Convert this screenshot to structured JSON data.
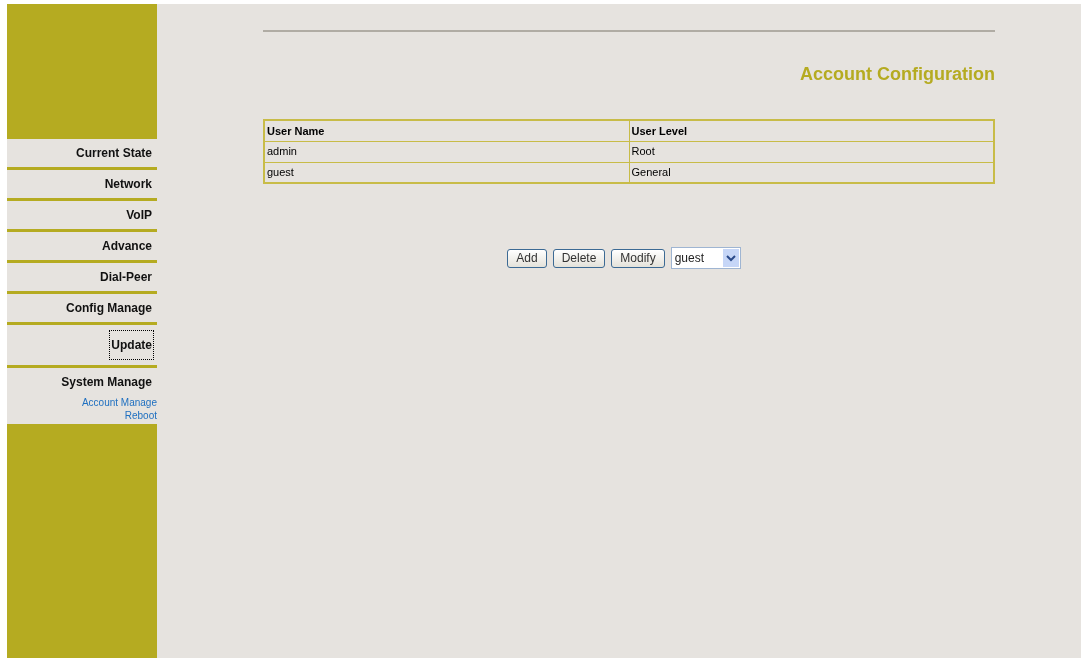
{
  "sidebar": {
    "items": [
      {
        "label": "Current State",
        "focused": false
      },
      {
        "label": "Network",
        "focused": false
      },
      {
        "label": "VoIP",
        "focused": false
      },
      {
        "label": "Advance",
        "focused": false
      },
      {
        "label": "Dial-Peer",
        "focused": false
      },
      {
        "label": "Config Manage",
        "focused": false
      },
      {
        "label": "Update",
        "focused": true
      },
      {
        "label": "System Manage",
        "focused": false,
        "children": [
          {
            "label": "Account Manage"
          },
          {
            "label": "Reboot"
          }
        ]
      }
    ]
  },
  "title": "Account Configuration",
  "table": {
    "columns": [
      "User Name",
      "User Level"
    ],
    "rows": [
      [
        "admin",
        "Root"
      ],
      [
        "guest",
        "General"
      ]
    ]
  },
  "buttons": [
    "Add",
    "Delete",
    "Modify"
  ],
  "user_select": {
    "value": "guest"
  }
}
